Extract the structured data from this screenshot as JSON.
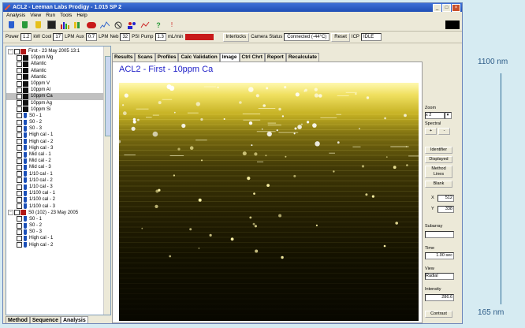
{
  "window": {
    "title": "ACL2 - Leeman Labs Prodigy - 1.015 SP 2"
  },
  "menu": [
    "Analysis",
    "View",
    "Run",
    "Tools",
    "Help"
  ],
  "statusbar": {
    "power_label": "Power",
    "power_value": "1.2",
    "power_unit": "kW",
    "cool_label": "Cool",
    "cool_value": "17",
    "cool_unit": "LPM",
    "aux_label": "Aux",
    "aux_value": "0.7",
    "aux_unit": "LPM",
    "neb_label": "Neb",
    "neb_value": "32",
    "neb_unit": "PSI",
    "pump_label": "Pump",
    "pump_value": "1.3",
    "pump_unit": "mL/min",
    "interlocks_label": "Interlocks",
    "camera_status_label": "Camera Status",
    "camera_status_value": "Connected (-44°C)",
    "reset_label": "Reset",
    "icp_label": "ICP",
    "icp_value": "IDLE",
    "alarm_color": "#c81a1a"
  },
  "tree": {
    "groups": [
      {
        "label": "First - 23 May 2005 13:1"
      },
      {
        "label": "S0 (102) - 23 May 2005"
      }
    ],
    "first_items": [
      "10ppm Mg",
      "Atlantic",
      "Atlantic",
      "Atlantic",
      "10ppm V",
      "10ppm Al",
      "10ppm Ca",
      "10ppm Ag",
      "10ppm Si"
    ],
    "selected": "10ppm Ca",
    "std_items": [
      "S0 - 1",
      "S0 - 2",
      "S0 - 3",
      "High cal - 1",
      "High cal - 2",
      "High cal - 3",
      "Mid cal - 1",
      "Mid cal - 2",
      "Mid cal - 3",
      "1/10 cal - 1",
      "1/10 cal - 2",
      "1/10 cal - 3",
      "1/100 cal - 1",
      "1/100 cal - 2",
      "1/100 cal - 3"
    ],
    "second_items": [
      "S0 - 1",
      "S0 - 2",
      "S0 - 3",
      "High cal - 1",
      "High cal - 2"
    ]
  },
  "left_tabs": [
    "Method",
    "Sequence",
    "Analysis"
  ],
  "tabs": [
    "Results",
    "Scans",
    "Profiles",
    "Calc Validation",
    "Image",
    "Ctrl Chrt",
    "Report",
    "Recalculate"
  ],
  "active_tab": "Image",
  "image": {
    "title": "ACL2 - First - 10ppm Ca"
  },
  "controls": {
    "zoom_label": "Zoom",
    "zoom_value": "x 2",
    "spectral_label": "Spectral",
    "plus_label": "+",
    "minus_label": "-",
    "identifier_label": "Identifier",
    "displayed_label": "Displayed",
    "method_lines_label": "Method Lines",
    "blank_label": "Blank",
    "x_label": "X",
    "x_value": "512",
    "y_label": "Y",
    "y_value": "338",
    "subarray_label": "Subarray",
    "time_label": "Time",
    "time_value": "1.00 sec",
    "view_label": "View",
    "view_value": "Radial",
    "intensity_label": "Intensity",
    "intensity_value": "286.6",
    "contrast_label": "Contrast"
  },
  "wavelength": {
    "top": "1100 nm",
    "bottom": "165 nm"
  }
}
